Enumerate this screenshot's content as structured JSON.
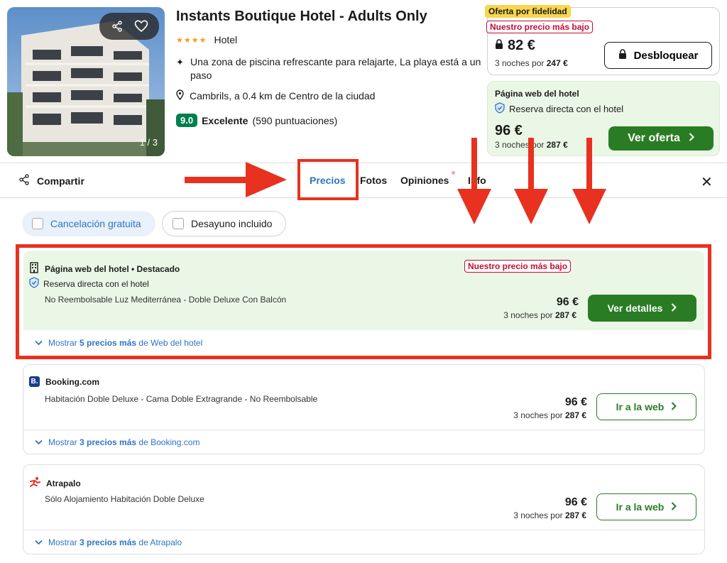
{
  "hotel": {
    "name": "Instants Boutique Hotel - Adults Only",
    "stars": "★★★★",
    "type": "Hotel",
    "feature": "Una zona de piscina refrescante para relajarte, La playa está a un paso",
    "location": "Cambrils, a 0.4 km de Centro de la ciudad",
    "rating_score": "9.0",
    "rating_word": "Excelente",
    "rating_count": "(590 puntuaciones)",
    "photo_counter": "1 / 3"
  },
  "loyalty_offer": {
    "badge": "Oferta por fidelidad",
    "lowest_badge": "Nuestro precio más bajo",
    "price": "82 €",
    "nights_text": "3 noches por",
    "total": "247 €",
    "button": "Desbloquear"
  },
  "hotel_offer": {
    "label": "Página web del hotel",
    "direct": "Reserva directa con el hotel",
    "price": "96 €",
    "nights_text": "3 noches por",
    "total": "287 €",
    "button": "Ver oferta"
  },
  "tabs": {
    "share": "Compartir",
    "items": [
      "Precios",
      "Fotos",
      "Opiniones",
      "Info"
    ]
  },
  "filters": [
    "Cancelación gratuita",
    "Desayuno incluido"
  ],
  "offers": [
    {
      "provider": "Página web del hotel • Destacado",
      "direct": "Reserva directa con el hotel",
      "badge": "Nuestro precio más bajo",
      "room": "No Reembolsable Luz Mediterránea - Doble Deluxe Con Balcón",
      "price": "96 €",
      "nights_text": "3 noches por",
      "total": "287 €",
      "button": "Ver detalles",
      "more_prefix": "Mostrar",
      "more_count": "5 precios más",
      "more_suffix": "de Web del hotel"
    },
    {
      "provider": "Booking.com",
      "logo": "B.",
      "room": "Habitación Doble Deluxe - Cama Doble Extragrande - No Reembolsable",
      "price": "96 €",
      "nights_text": "3 noches por",
      "total": "287 €",
      "button": "Ir a la web",
      "more_prefix": "Mostrar",
      "more_count": "3 precios más",
      "more_suffix": "de Booking.com"
    },
    {
      "provider": "Atrapalo",
      "room": "Sólo Alojamiento Habitación Doble Deluxe",
      "price": "96 €",
      "nights_text": "3 noches por",
      "total": "287 €",
      "button": "Ir a la web",
      "more_prefix": "Mostrar",
      "more_count": "3 precios más",
      "more_suffix": "de Atrapalo"
    }
  ],
  "icons": {
    "share": "share-icon",
    "heart": "heart-icon",
    "sparkle": "sparkle-icon",
    "pin": "map-pin-icon",
    "lock": "lock-icon",
    "shield": "shield-check-icon",
    "chevron": "chevron-right-icon",
    "close": "close-icon"
  },
  "colors": {
    "accent_blue": "#2e74c4",
    "cta_green": "#2a7c24",
    "highlight_red": "#e8311f",
    "badge_red": "#c40d34",
    "loyalty_yellow": "#f8d64e",
    "offer_bg": "#ebf7e6"
  }
}
